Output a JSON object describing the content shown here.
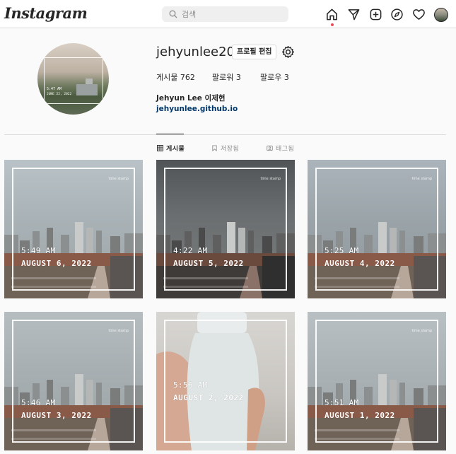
{
  "app": {
    "logo": "Instagram"
  },
  "search": {
    "placeholder": "검색"
  },
  "nav": {
    "icons": [
      "home-icon",
      "direct-icon",
      "new-post-icon",
      "explore-icon",
      "activity-icon",
      "profile-avatar"
    ]
  },
  "profile": {
    "username": "jehyunlee20",
    "edit_button": "프로필 편집",
    "posts_label": "게시물",
    "posts_count": "762",
    "followers_label": "팔로워",
    "followers_count": "3",
    "following_label": "팔로우",
    "following_count": "3",
    "full_name": "Jehyun Lee 이제현",
    "website": "jehyunlee.github.io",
    "avatar": {
      "time": "5:47 AM",
      "date": "JUNE 22, 2022"
    }
  },
  "tabs": [
    {
      "label": "게시물",
      "icon": "grid-icon",
      "active": true
    },
    {
      "label": "저장됨",
      "icon": "bookmark-icon",
      "active": false
    },
    {
      "label": "태그됨",
      "icon": "tagged-icon",
      "active": false
    }
  ],
  "posts": [
    {
      "time": "5:49 AM",
      "date": "AUGUST 6, 2022",
      "stamp": "time stamp"
    },
    {
      "time": "4:22 AM",
      "date": "AUGUST 5, 2022",
      "stamp": "time stamp"
    },
    {
      "time": "5:25 AM",
      "date": "AUGUST 4, 2022",
      "stamp": "time stamp"
    },
    {
      "time": "5:46 AM",
      "date": "AUGUST 3, 2022",
      "stamp": "time stamp"
    },
    {
      "time": "5:56 AM",
      "date": "AUGUST 2, 2022",
      "stamp": ""
    },
    {
      "time": "5:51 AM",
      "date": "AUGUST 1, 2022",
      "stamp": "time stamp"
    }
  ],
  "colors": {
    "accent_link": "#00376b",
    "notification_dot": "#ed4956",
    "border": "#dbdbdb"
  }
}
